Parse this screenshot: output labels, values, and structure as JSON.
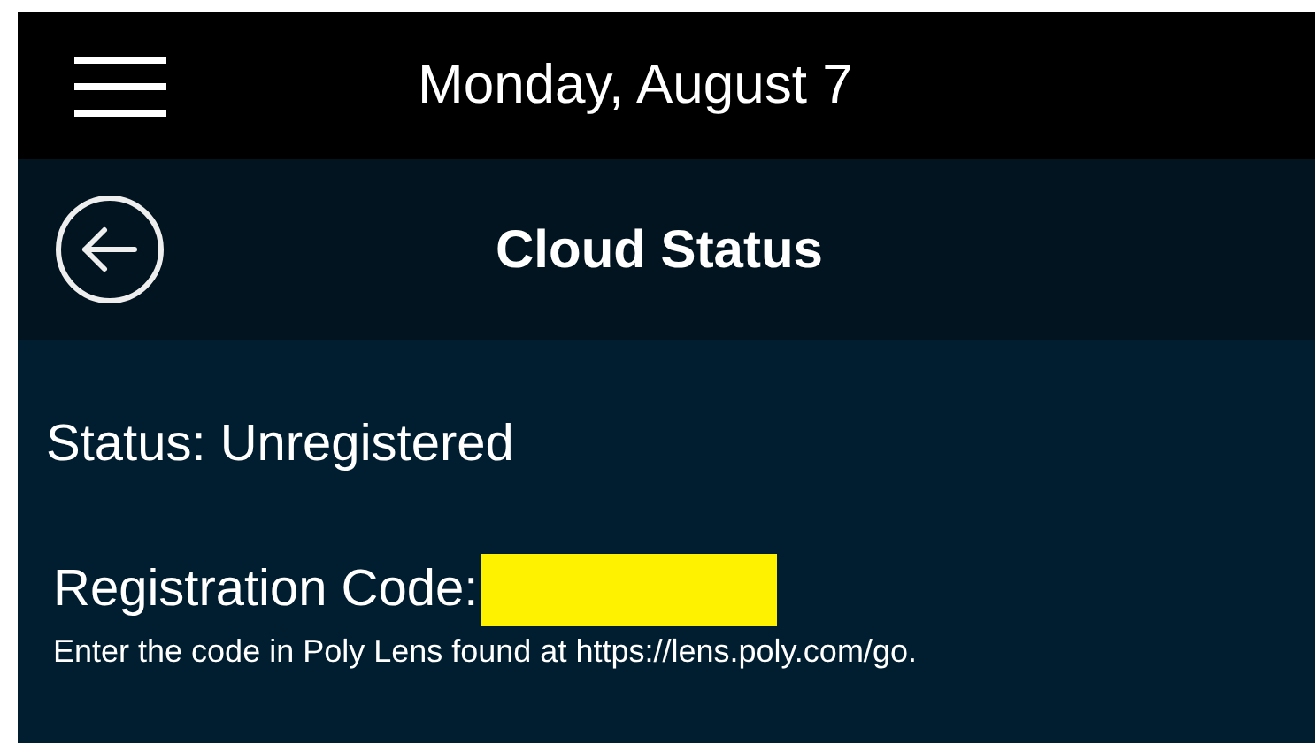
{
  "top_bar": {
    "date": "Monday, August 7"
  },
  "header": {
    "title": "Cloud Status"
  },
  "status": "Status: Unregistered",
  "registration": {
    "label": "Registration Code:",
    "hint": "Enter the code in Poly Lens found at https://lens.poly.com/go."
  }
}
